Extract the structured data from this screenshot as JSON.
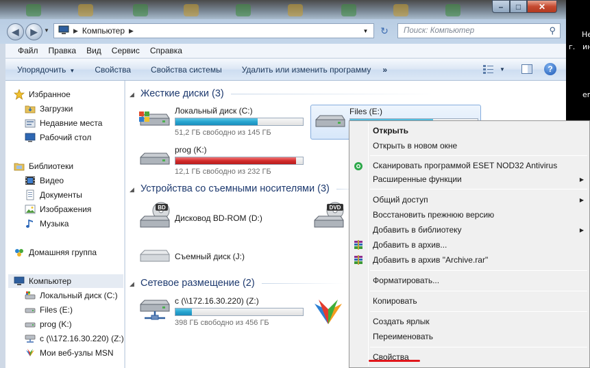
{
  "window": {
    "caption": {
      "minimize": "–",
      "maximize": "□",
      "close": "✕"
    }
  },
  "address": {
    "crumb": "Компьютер",
    "search_placeholder": "Поиск: Компьютер"
  },
  "menu": [
    "Файл",
    "Правка",
    "Вид",
    "Сервис",
    "Справка"
  ],
  "commands": {
    "organize": "Упорядочить",
    "properties": "Свойства",
    "system_properties": "Свойства системы",
    "uninstall": "Удалить или изменить программу",
    "more": "»"
  },
  "nav": {
    "favorites": "Избранное",
    "downloads": "Загрузки",
    "recent": "Недавние места",
    "desktop": "Рабочий стол",
    "libraries": "Библиотеки",
    "video": "Видео",
    "documents": "Документы",
    "pictures": "Изображения",
    "music": "Музыка",
    "homegroup": "Домашняя группа",
    "computer": "Компьютер",
    "drive_c": "Локальный диск (C:)",
    "drive_e": "Files (E:)",
    "drive_k": "prog (K:)",
    "drive_z": "c (\\\\172.16.30.220) (Z:)",
    "msn": "Мои веб-узлы MSN"
  },
  "groups": {
    "hdd": "Жесткие диски (3)",
    "removable": "Устройства со съемными носителями (3)",
    "network": "Сетевое размещение (2)"
  },
  "drives": {
    "c": {
      "name": "Локальный диск (C:)",
      "free": "51,2 ГБ свободно из 145 ГБ",
      "used": 0.647
    },
    "e": {
      "name": "Files (E:)",
      "used": 0.65
    },
    "k": {
      "name": "prog (K:)",
      "free": "12,1 ГБ свободно из 232 ГБ",
      "used": 0.948
    },
    "bd": {
      "name": "Дисковод BD-ROM (D:)",
      "badge": "BD"
    },
    "dvd": {
      "badge": "DVD"
    },
    "j": {
      "name": "Съемный диск (J:)"
    },
    "z": {
      "name": "c (\\\\172.16.30.220) (Z:)",
      "free": "398 ГБ свободно из 456 ГБ",
      "used": 0.127
    }
  },
  "context_menu": {
    "open": "Открыть",
    "open_new": "Открыть в новом окне",
    "scan": "Сканировать программой ESET NOD32 Antivirus",
    "advanced": "Расширенные функции",
    "share": "Общий доступ",
    "restore": "Восстановить прежнюю версию",
    "add_library": "Добавить в библиотеку",
    "add_archive": "Добавить в архив...",
    "add_archive_rar": "Добавить в архив \"Archive.rar\"",
    "format": "Форматировать...",
    "copy": "Копировать",
    "shortcut": "Создать ярлык",
    "rename": "Переименовать",
    "properties": "Свойства"
  },
  "desktop_text": {
    "a": "Не",
    "b": "г.",
    "c": "ин",
    "d": "en"
  },
  "colors": {
    "accent_blue": "#27a5d0",
    "critical_red": "#d42b2b",
    "underline": "#e0161b"
  }
}
